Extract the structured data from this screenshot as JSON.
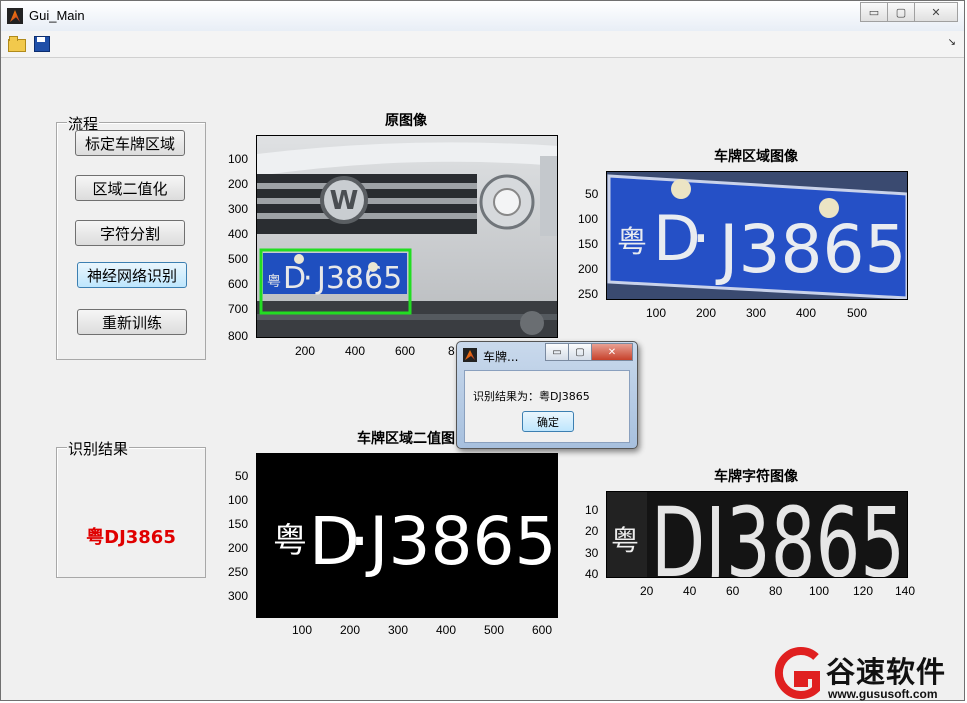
{
  "window": {
    "title": "Gui_Main",
    "min_glyph": "▭",
    "max_glyph": "▢",
    "close_glyph": "✕"
  },
  "toolbar": {
    "open_icon": "open-folder-icon",
    "save_icon": "save-disk-icon",
    "overflow_glyph": "↘"
  },
  "flow_panel": {
    "title": "流程",
    "buttons": [
      "标定车牌区域",
      "区域二值化",
      "字符分割",
      "神经网络识别",
      "重新训练"
    ]
  },
  "result_panel": {
    "title": "识别结果",
    "value": "粤DJ3865",
    "color": "#e00000"
  },
  "axes": {
    "original": {
      "title": "原图像",
      "y_ticks": [
        "100",
        "200",
        "300",
        "400",
        "500",
        "600",
        "700",
        "800"
      ],
      "x_ticks": [
        "200",
        "400",
        "600",
        "8"
      ]
    },
    "plate_region": {
      "title": "车牌区域图像",
      "y_ticks": [
        "50",
        "100",
        "150",
        "200",
        "250"
      ],
      "x_ticks": [
        "100",
        "200",
        "300",
        "400",
        "500"
      ]
    },
    "binary": {
      "title": "车牌区域二值图",
      "y_ticks": [
        "50",
        "100",
        "150",
        "200",
        "250",
        "300"
      ],
      "x_ticks": [
        "100",
        "200",
        "300",
        "400",
        "500",
        "600"
      ]
    },
    "chars": {
      "title": "车牌字符图像",
      "y_ticks": [
        "10",
        "20",
        "30",
        "40"
      ],
      "x_ticks": [
        "20",
        "40",
        "60",
        "80",
        "100",
        "120",
        "140"
      ]
    }
  },
  "plate_glyphs": {
    "province": "粤",
    "letter": "D",
    "dot": "·",
    "number": "J3865",
    "all": "DJ3865"
  },
  "dialog": {
    "title": "车牌...",
    "message": "识别结果为：粤DJ3865",
    "ok_label": "确定"
  },
  "watermark": {
    "name": "谷速软件",
    "url": "www.gususoft.com",
    "color": "#e02020"
  }
}
